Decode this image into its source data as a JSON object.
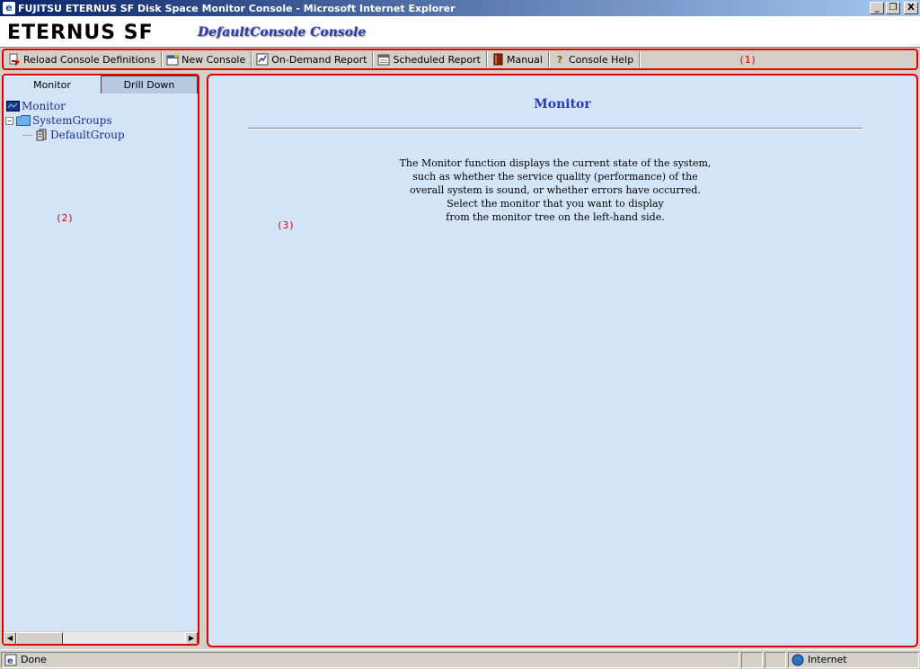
{
  "window": {
    "title": "FUJITSU ETERNUS SF Disk Space Monitor Console - Microsoft Internet Explorer",
    "buttons": {
      "minimize": "_",
      "restore": "❐",
      "close": "X"
    }
  },
  "header": {
    "logo": "ETERNUS SF",
    "console_name": "DefaultConsole Console"
  },
  "toolbar": {
    "items": [
      {
        "label": "Reload Console Definitions",
        "icon": "reload-icon"
      },
      {
        "label": "New Console",
        "icon": "new-console-icon"
      },
      {
        "label": "On-Demand Report",
        "icon": "chart-report-icon"
      },
      {
        "label": "Scheduled Report",
        "icon": "calendar-report-icon"
      },
      {
        "label": "Manual",
        "icon": "book-icon"
      },
      {
        "label": "Console Help",
        "icon": "help-icon"
      }
    ],
    "marker": "(1)"
  },
  "left_panel": {
    "tabs": [
      {
        "label": "Monitor",
        "active": true
      },
      {
        "label": "Drill Down",
        "active": false
      }
    ],
    "tree": [
      {
        "label": "Monitor",
        "icon": "monitor-icon",
        "level": 0
      },
      {
        "label": "SystemGroups",
        "icon": "folder-icon",
        "level": 0,
        "expander": "−"
      },
      {
        "label": "DefaultGroup",
        "icon": "server-group-icon",
        "level": 1
      }
    ],
    "marker": "(2)"
  },
  "main": {
    "title": "Monitor",
    "description": [
      "The Monitor function displays the current state of the system,",
      "such as whether the service quality (performance) of the",
      "overall system is sound, or whether errors have occurred.",
      "Select the monitor that you want to display",
      "from the monitor tree on the left-hand side."
    ],
    "marker": "(3)"
  },
  "statusbar": {
    "status": "Done",
    "zone": "Internet"
  },
  "colors": {
    "highlight_border": "#e00000",
    "panel_bg": "#d4e4f8",
    "link_blue": "#2b3bb5"
  }
}
